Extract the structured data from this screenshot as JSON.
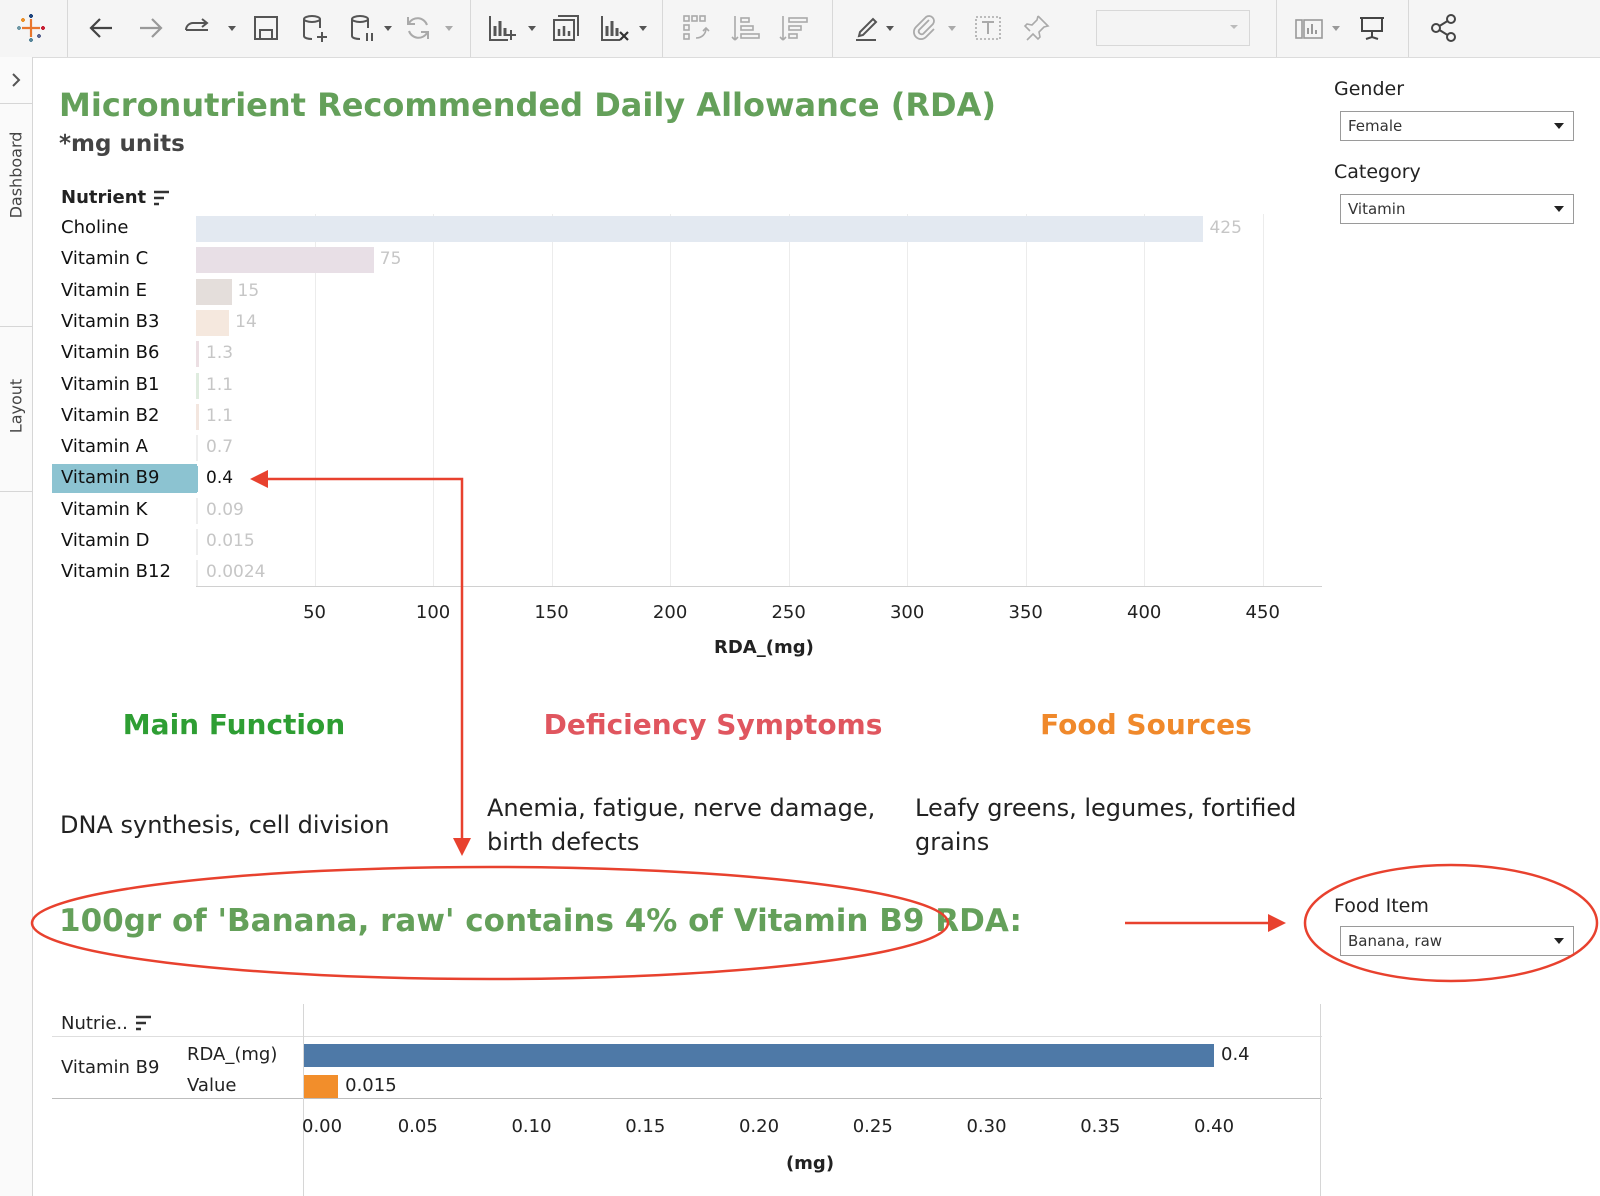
{
  "toolbar": {
    "icons": [
      "tableau-logo-icon",
      "back-icon",
      "forward-icon",
      "redo-icon",
      "save-icon",
      "new-datasource-icon",
      "pause-updates-icon",
      "refresh-icon",
      "new-worksheet-icon",
      "duplicate-sheet-icon",
      "clear-sheet-icon",
      "swap-axes-icon",
      "sort-ascending-icon",
      "sort-descending-icon",
      "highlight-icon",
      "attach-icon",
      "text-box-icon",
      "pin-icon",
      "show-me-icon",
      "presentation-icon",
      "share-icon"
    ]
  },
  "siderail": {
    "tabs": [
      "Dashboard",
      "Layout"
    ]
  },
  "header": {
    "title": "Micronutrient Recommended Daily Allowance (RDA)",
    "subtitle": "*mg units"
  },
  "filters": {
    "gender": {
      "label": "Gender",
      "value": "Female"
    },
    "category": {
      "label": "Category",
      "value": "Vitamin"
    },
    "food_item": {
      "label": "Food Item",
      "value": "Banana, raw"
    }
  },
  "chart_data": [
    {
      "type": "bar",
      "orientation": "horizontal",
      "row_header": "Nutrient",
      "categories": [
        "Choline",
        "Vitamin C",
        "Vitamin E",
        "Vitamin B3",
        "Vitamin B6",
        "Vitamin B1",
        "Vitamin B2",
        "Vitamin A",
        "Vitamin B9",
        "Vitamin K",
        "Vitamin D",
        "Vitamin B12"
      ],
      "values": [
        425,
        75,
        15,
        14,
        1.3,
        1.1,
        1.1,
        0.7,
        0.4,
        0.09,
        0.015,
        0.0024
      ],
      "value_labels": [
        "425",
        "75",
        "15",
        "14",
        "1.3",
        "1.1",
        "1.1",
        "0.7",
        "0.4",
        "0.09",
        "0.015",
        "0.0024"
      ],
      "bar_colors": [
        "#e3e9f1",
        "#e8dfe6",
        "#e4dedb",
        "#f5e8de",
        "#ecdfe3",
        "#dfecdf",
        "#f3e6df",
        "#eeeeee",
        "#8cc3d1",
        "#eeeeee",
        "#eeeeee",
        "#eeeeee"
      ],
      "selected": "Vitamin B9",
      "xlabel": "RDA_(mg)",
      "xticks": [
        "50",
        "100",
        "150",
        "200",
        "250",
        "300",
        "350",
        "400",
        "450"
      ],
      "xlim": [
        0,
        475
      ],
      "grid": true
    },
    {
      "type": "bar",
      "orientation": "horizontal",
      "row_header": "Nutrie..",
      "group": "Vitamin B9",
      "categories": [
        "RDA_(mg)",
        "Value"
      ],
      "values": [
        0.4,
        0.015
      ],
      "value_labels": [
        "0.4",
        "0.015"
      ],
      "colors": [
        "#4e79a7",
        "#f28e2b"
      ],
      "xlabel": "(mg)",
      "xticks": [
        "0.00",
        "0.05",
        "0.10",
        "0.15",
        "0.20",
        "0.25",
        "0.30",
        "0.35",
        "0.40"
      ],
      "xlim": [
        0,
        0.4
      ]
    }
  ],
  "details": {
    "main_function": {
      "heading": "Main Function",
      "text": "DNA synthesis, cell division",
      "color": "#2e9e33"
    },
    "deficiency": {
      "heading": "Deficiency Symptoms",
      "text": "Anemia, fatigue, nerve damage, birth defects",
      "color": "#e0565f"
    },
    "food_sources": {
      "heading": "Food Sources",
      "text": "Leafy greens, legumes, fortified grains",
      "color": "#f0892b"
    }
  },
  "summary": "100gr of 'Banana, raw' contains 4% of Vitamin B9 RDA:",
  "colors": {
    "accent_green": "#64a05a",
    "annotation_red": "#e8412e",
    "selected_bar": "#8cc3d1"
  }
}
